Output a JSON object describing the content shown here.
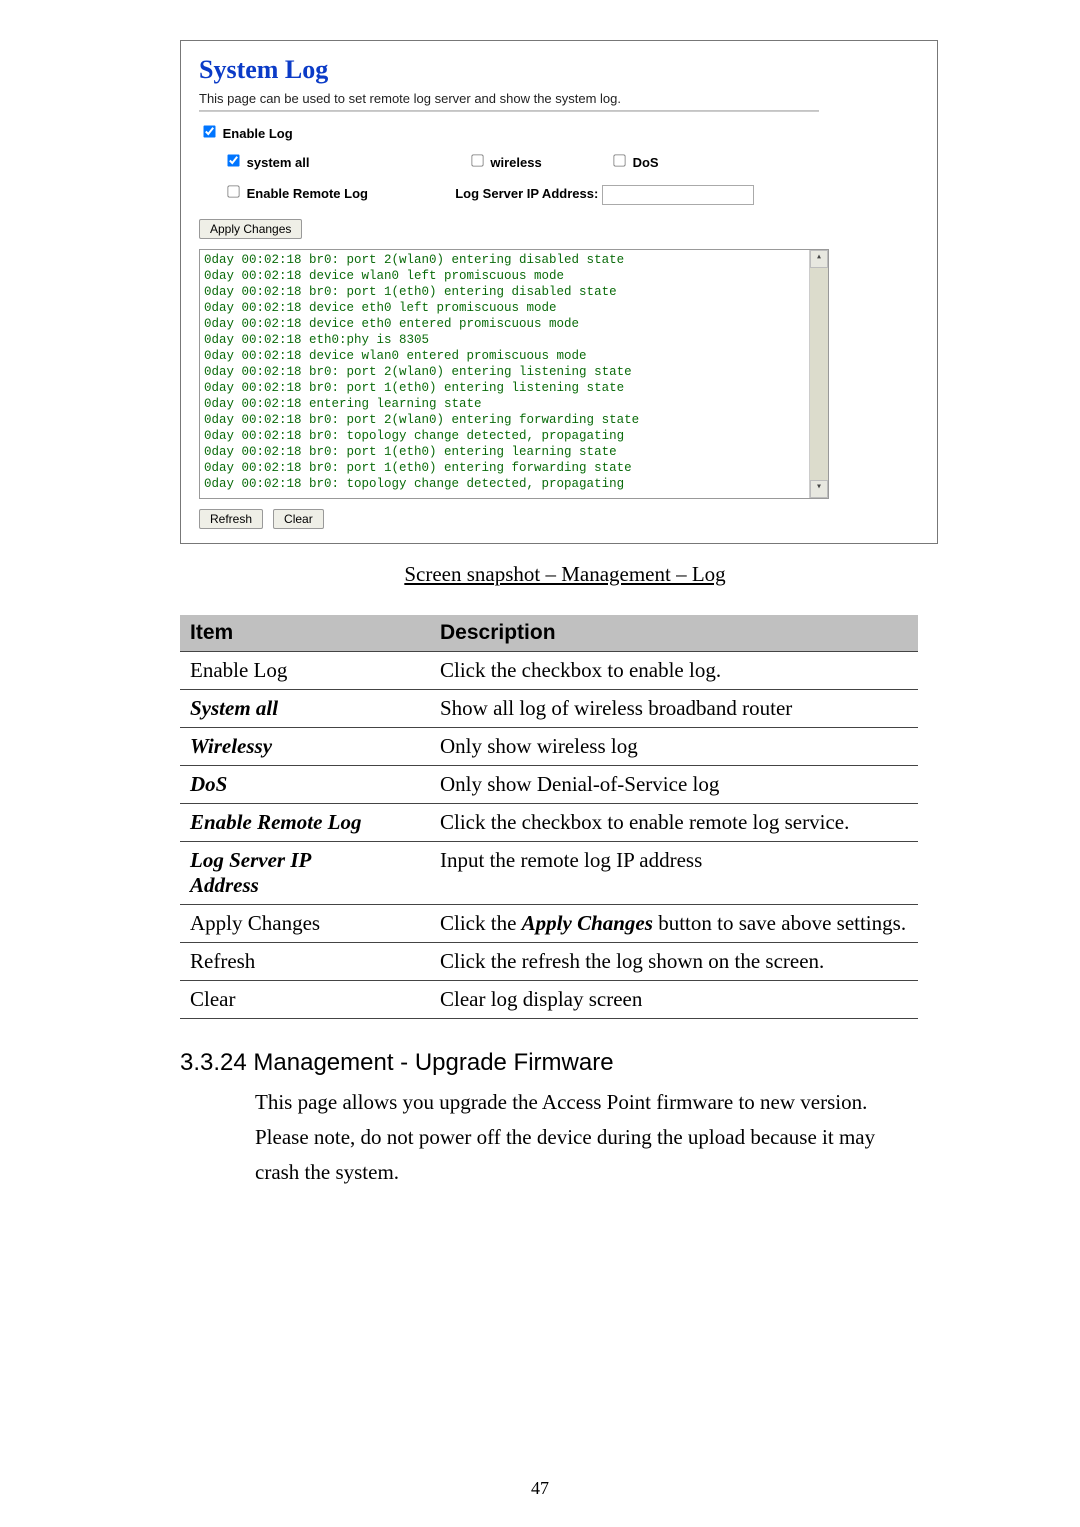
{
  "syslog": {
    "title": "System Log",
    "desc": "This page can be used to set remote log server and show the system log.",
    "enable_log_label": "Enable Log",
    "system_all_label": "system all",
    "wireless_label": "wireless",
    "dos_label": "DoS",
    "enable_remote_label": "Enable Remote Log",
    "log_server_ip_label": "Log Server IP Address:",
    "apply_changes_label": "Apply Changes",
    "refresh_label": "Refresh",
    "clear_label": "Clear",
    "log_lines": [
      "0day 00:02:18 br0: port 2(wlan0) entering disabled state",
      "0day 00:02:18 device wlan0 left promiscuous mode",
      "0day 00:02:18 br0: port 1(eth0) entering disabled state",
      "0day 00:02:18 device eth0 left promiscuous mode",
      "0day 00:02:18 device eth0 entered promiscuous mode",
      "0day 00:02:18 eth0:phy is 8305",
      "0day 00:02:18 device wlan0 entered promiscuous mode",
      "0day 00:02:18 br0: port 2(wlan0) entering listening state",
      "0day 00:02:18 br0: port 1(eth0) entering listening state",
      "0day 00:02:18 entering learning state",
      "0day 00:02:18 br0: port 2(wlan0) entering forwarding state",
      "0day 00:02:18 br0: topology change detected, propagating",
      "0day 00:02:18 br0: port 1(eth0) entering learning state",
      "0day 00:02:18 br0: port 1(eth0) entering forwarding state",
      "0day 00:02:18 br0: topology change detected, propagating"
    ]
  },
  "caption": "Screen snapshot – Management – Log",
  "table": {
    "header_item": "Item",
    "header_desc": "Description",
    "rows": [
      {
        "item": "Enable Log",
        "item_style": "plain",
        "desc_parts": [
          {
            "t": "Click the checkbox to enable log.",
            "s": "plain"
          }
        ]
      },
      {
        "item": "System all",
        "item_style": "italic",
        "desc_parts": [
          {
            "t": "Show all log of wireless broadband router",
            "s": "plain"
          }
        ]
      },
      {
        "item": "Wirelessy",
        "item_style": "italic",
        "desc_parts": [
          {
            "t": "Only show wireless log",
            "s": "plain"
          }
        ]
      },
      {
        "item": "DoS",
        "item_style": "italic",
        "desc_parts": [
          {
            "t": "Only show Denial-of-Service log",
            "s": "plain"
          }
        ]
      },
      {
        "item": "Enable Remote Log",
        "item_style": "italic",
        "desc_parts": [
          {
            "t": "Click the checkbox to enable remote log service.",
            "s": "plain"
          }
        ]
      },
      {
        "item": "Log Server IP Address",
        "item_style": "italicmulti",
        "desc_parts": [
          {
            "t": "Input the remote log IP address",
            "s": "plain"
          }
        ]
      },
      {
        "item": "Apply Changes",
        "item_style": "plain",
        "desc_parts": [
          {
            "t": "Click the ",
            "s": "plain"
          },
          {
            "t": "Apply Changes",
            "s": "italic"
          },
          {
            "t": " button to save above settings.",
            "s": "plain"
          }
        ]
      },
      {
        "item": "Refresh",
        "item_style": "plain",
        "desc_parts": [
          {
            "t": "Click the refresh the log shown on the screen.",
            "s": "plain"
          }
        ]
      },
      {
        "item": "Clear",
        "item_style": "plain",
        "desc_parts": [
          {
            "t": "Clear log display screen",
            "s": "plain"
          }
        ]
      }
    ]
  },
  "section": {
    "num": "3.3.24",
    "title": "Management - Upgrade Firmware",
    "body": "This page allows you upgrade the Access Point firmware to new version. Please note, do not power off the device during the upload because it may crash the system."
  },
  "page_number": "47"
}
